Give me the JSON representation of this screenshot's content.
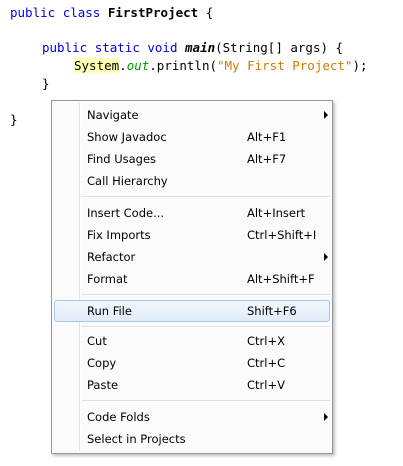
{
  "editor": {
    "line1": {
      "kw1": "public",
      "kw2": "class",
      "class_name": "FirstProject",
      "brace": "{"
    },
    "line2": {
      "kw1": "public",
      "kw2": "static",
      "kw3": "void",
      "method": "main",
      "params": "(String[] args) {"
    },
    "line3": {
      "system": "System",
      "dot1": ".",
      "out": "out",
      "call": ".println(",
      "string": "\"My First Project\"",
      "end": ");"
    },
    "line4": {
      "brace": "}"
    },
    "line5": {
      "brace": "}"
    }
  },
  "context_menu": {
    "items": [
      {
        "label": "Navigate",
        "shortcut": "",
        "submenu": true
      },
      {
        "label": "Show Javadoc",
        "shortcut": "Alt+F1",
        "submenu": false
      },
      {
        "label": "Find Usages",
        "shortcut": "Alt+F7",
        "submenu": false
      },
      {
        "label": "Call Hierarchy",
        "shortcut": "",
        "submenu": false
      },
      {
        "label": "Insert Code...",
        "shortcut": "Alt+Insert",
        "submenu": false
      },
      {
        "label": "Fix Imports",
        "shortcut": "Ctrl+Shift+I",
        "submenu": false
      },
      {
        "label": "Refactor",
        "shortcut": "",
        "submenu": true
      },
      {
        "label": "Format",
        "shortcut": "Alt+Shift+F",
        "submenu": false
      },
      {
        "label": "Run File",
        "shortcut": "Shift+F6",
        "submenu": false,
        "highlighted": true
      },
      {
        "label": "Cut",
        "shortcut": "Ctrl+X",
        "submenu": false
      },
      {
        "label": "Copy",
        "shortcut": "Ctrl+C",
        "submenu": false
      },
      {
        "label": "Paste",
        "shortcut": "Ctrl+V",
        "submenu": false
      },
      {
        "label": "Code Folds",
        "shortcut": "",
        "submenu": true
      },
      {
        "label": "Select in Projects",
        "shortcut": "",
        "submenu": false
      }
    ]
  },
  "colors": {
    "keyword": "#0000e6",
    "string": "#ce7b00",
    "field": "#009900",
    "highlight": "#ffffb4",
    "menu_highlight_border": "#a8c8ea"
  }
}
